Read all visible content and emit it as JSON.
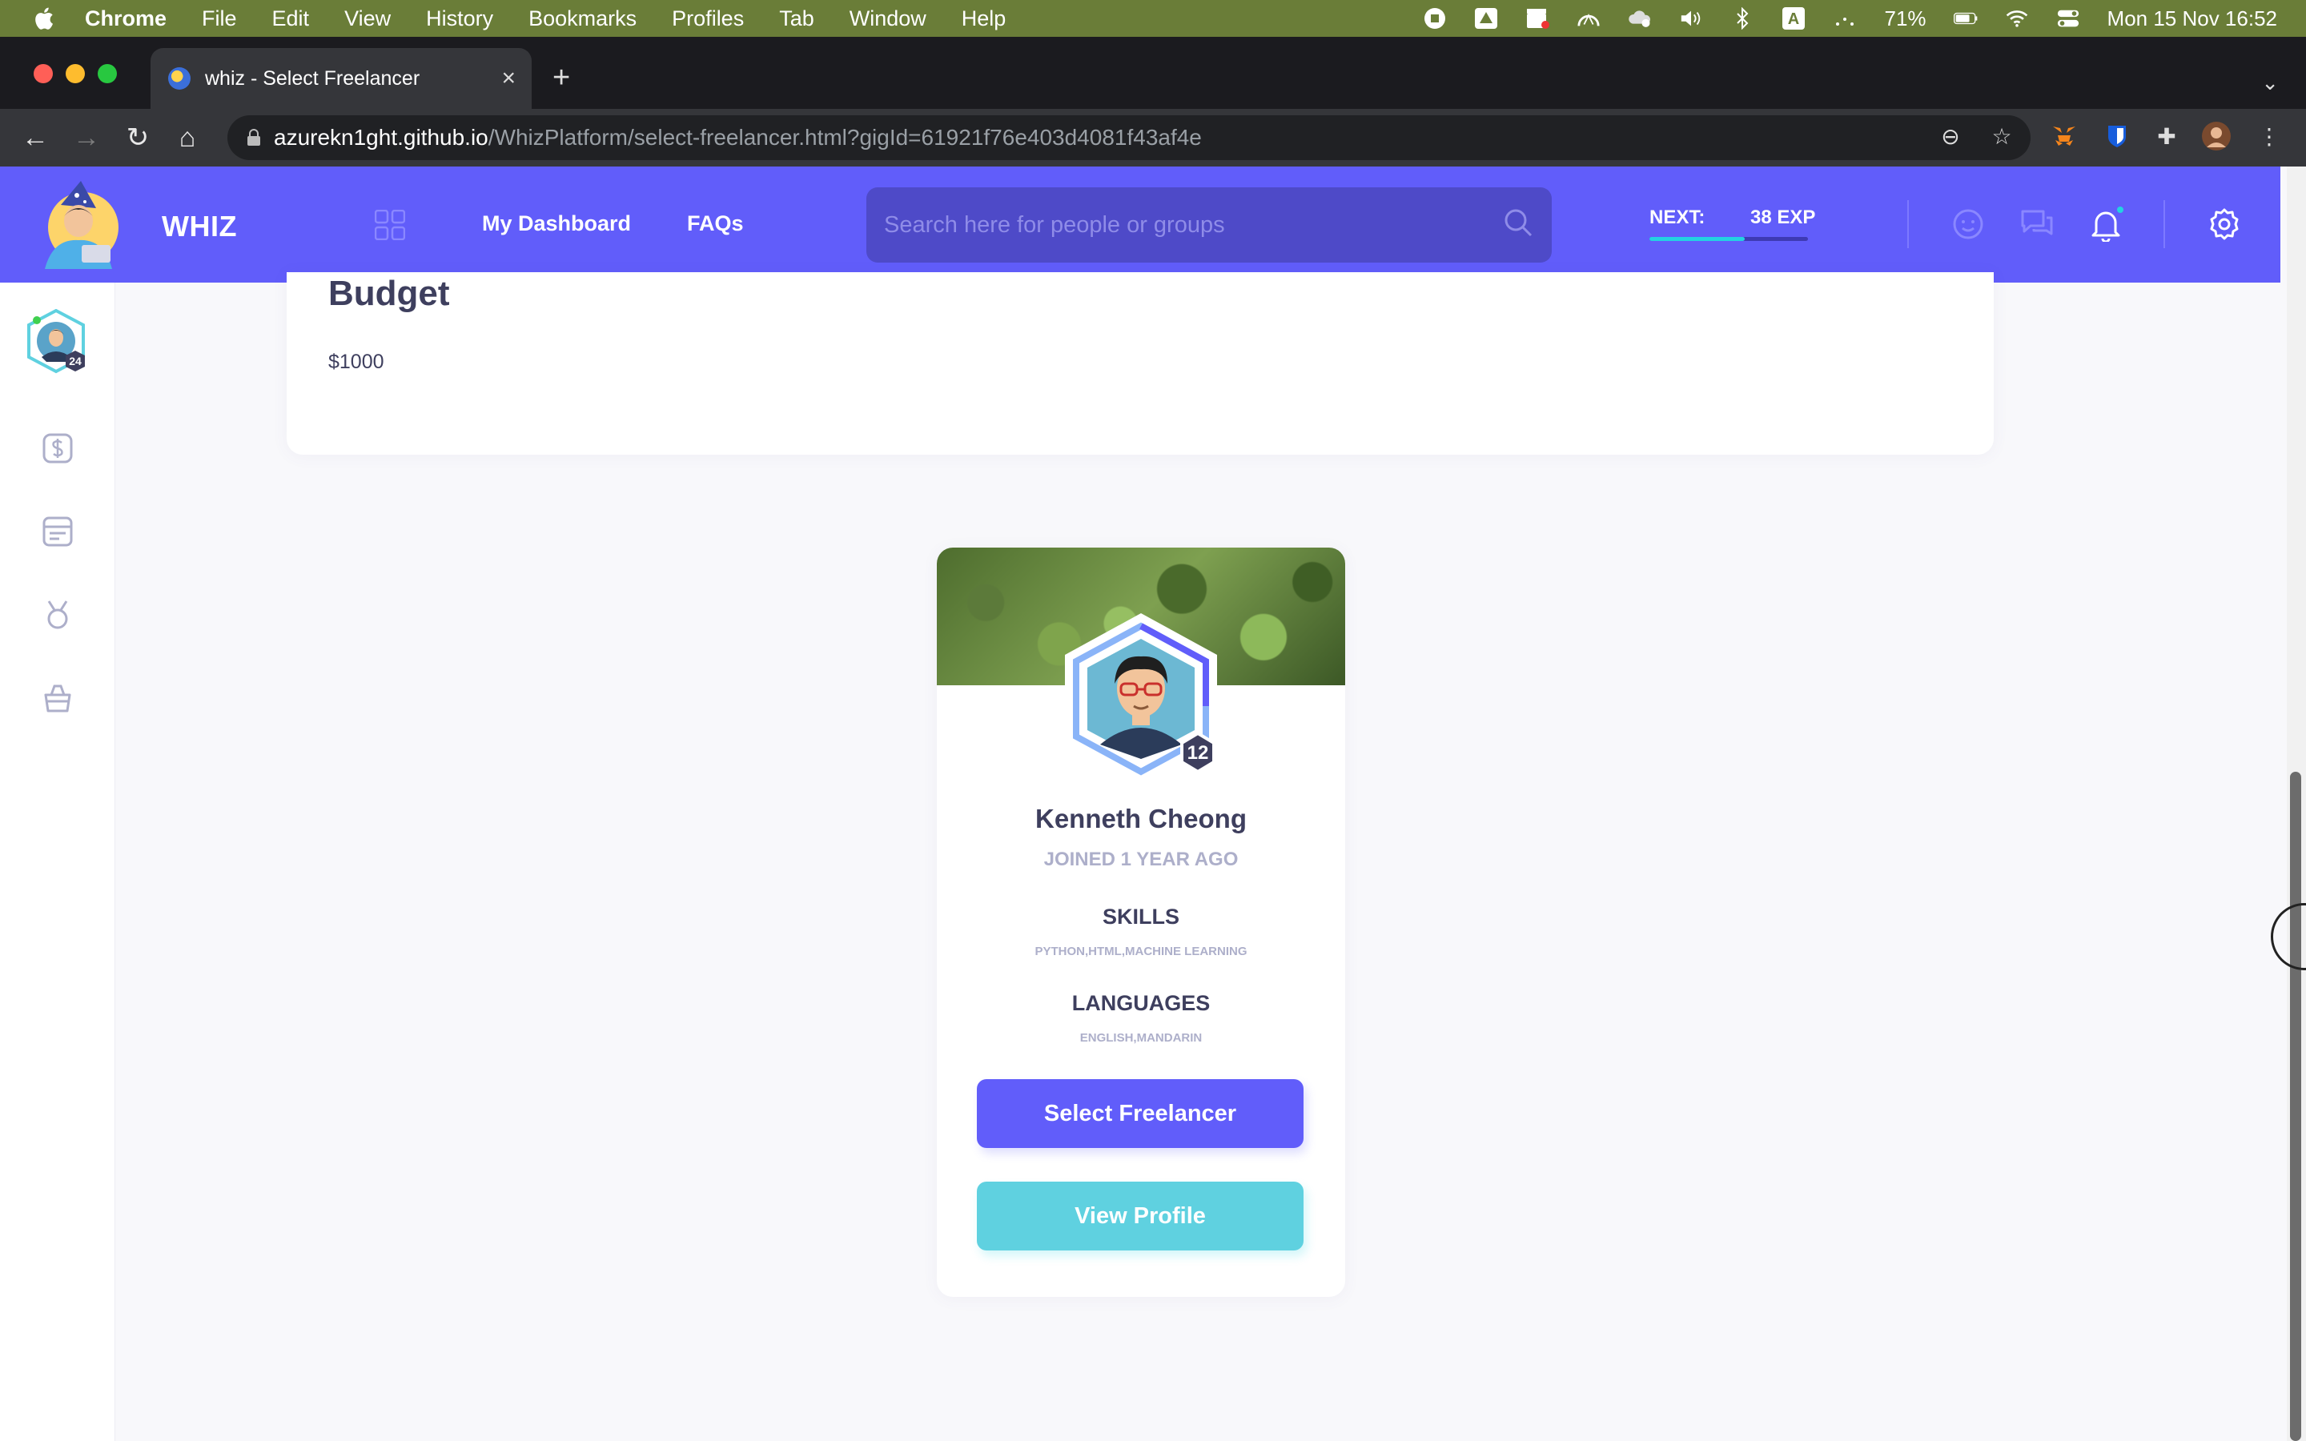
{
  "menubar": {
    "app": "Chrome",
    "items": [
      "File",
      "Edit",
      "View",
      "History",
      "Bookmarks",
      "Profiles",
      "Tab",
      "Window",
      "Help"
    ],
    "battery": "71%",
    "datetime": "Mon 15 Nov  16:52"
  },
  "browser": {
    "tab_title": "whiz - Select Freelancer",
    "url_host": "azurekn1ght.github.io",
    "url_path": "/WhizPlatform/select-freelancer.html?gigId=61921f76e403d4081f43af4e"
  },
  "header": {
    "brand": "WHIZ",
    "nav": [
      "My Dashboard",
      "FAQs"
    ],
    "search_placeholder": "Search here for people or groups",
    "next_label": "NEXT:",
    "exp_label": "38 EXP",
    "exp_progress": 0.6
  },
  "sidebar": {
    "avatar_level": "24",
    "icons": [
      "dollar-icon",
      "newsfeed-icon",
      "badge-icon",
      "store-icon"
    ]
  },
  "gig": {
    "budget_title": "Budget",
    "budget_value": "$1000"
  },
  "freelancer": {
    "level": "12",
    "name": "Kenneth Cheong",
    "joined": "JOINED 1 YEAR AGO",
    "skills_title": "SKILLS",
    "skills": "PYTHON,HTML,MACHINE LEARNING",
    "languages_title": "LANGUAGES",
    "languages": "ENGLISH,MANDARIN",
    "select_label": "Select Freelancer",
    "view_label": "View Profile"
  },
  "colors": {
    "primary": "#615dfa",
    "secondary": "#5fd1e0",
    "text_dark": "#3e3f5e",
    "text_muted": "#adafca"
  }
}
